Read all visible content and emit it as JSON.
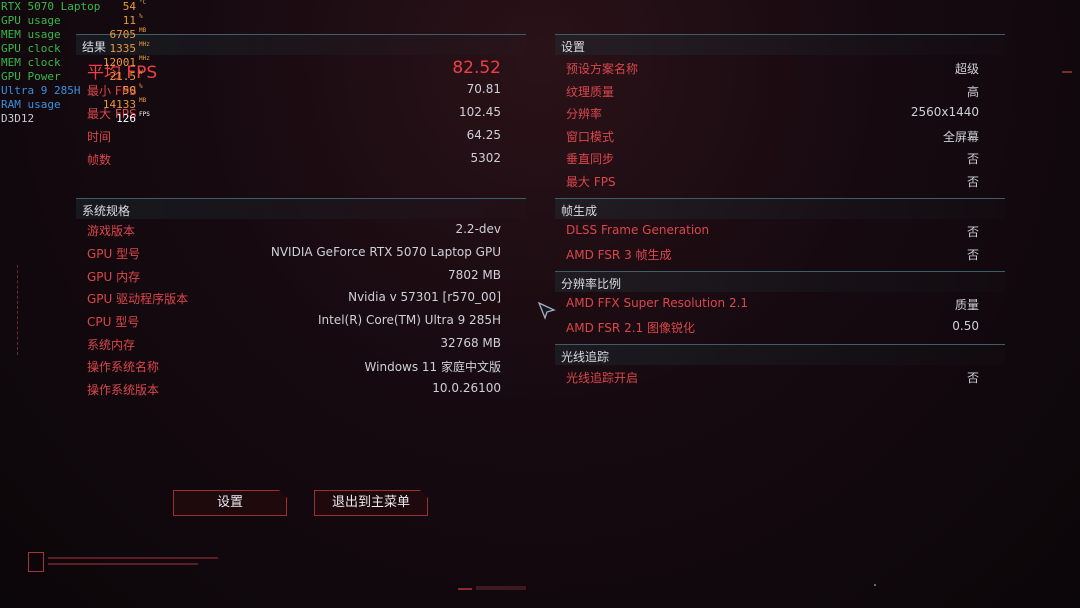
{
  "hud": [
    {
      "name": "RTX 5070 Laptop",
      "value": "54",
      "unit": "°C",
      "name_color": "#38b84a",
      "value_color": "#e89a3a"
    },
    {
      "name": "GPU usage",
      "value": "11",
      "unit": "%",
      "name_color": "#38b84a",
      "value_color": "#e89a3a"
    },
    {
      "name": "MEM usage",
      "value": "6705",
      "unit": "MB",
      "name_color": "#38b84a",
      "value_color": "#e89a3a"
    },
    {
      "name": "GPU clock",
      "value": "1335",
      "unit": "MHz",
      "name_color": "#38b84a",
      "value_color": "#e89a3a"
    },
    {
      "name": "MEM clock",
      "value": "12001",
      "unit": "MHz",
      "name_color": "#38b84a",
      "value_color": "#e89a3a"
    },
    {
      "name": "GPU Power",
      "value": "21.5",
      "unit": "W",
      "name_color": "#38b84a",
      "value_color": "#e89a3a"
    },
    {
      "name": "Ultra 9 285H",
      "value": "50",
      "unit": "%",
      "name_color": "#3a8fe0",
      "value_color": "#e89a3a"
    },
    {
      "name": "RAM usage",
      "value": "14133",
      "unit": "MB",
      "name_color": "#3a8fe0",
      "value_color": "#e89a3a"
    },
    {
      "name": "D3D12",
      "value": "126",
      "unit": "FPS",
      "name_color": "#c8ccd2",
      "value_color": "#ffffff"
    }
  ],
  "results": {
    "title": "结果",
    "rows": [
      {
        "label": "平均 FPS",
        "value": "82.52"
      },
      {
        "label": "最小 FPS",
        "value": "70.81"
      },
      {
        "label": "最大 FPS",
        "value": "102.45"
      },
      {
        "label": "时间",
        "value": "64.25"
      },
      {
        "label": "帧数",
        "value": "5302"
      }
    ]
  },
  "system": {
    "title": "系统规格",
    "rows": [
      {
        "label": "游戏版本",
        "value": "2.2-dev"
      },
      {
        "label": "GPU 型号",
        "value": "NVIDIA GeForce RTX 5070 Laptop GPU"
      },
      {
        "label": "GPU 内存",
        "value": "7802 MB"
      },
      {
        "label": "GPU 驱动程序版本",
        "value": "Nvidia v 57301 [r570_00]"
      },
      {
        "label": "CPU 型号",
        "value": "Intel(R) Core(TM) Ultra 9 285H"
      },
      {
        "label": "系统内存",
        "value": "32768 MB"
      },
      {
        "label": "操作系统名称",
        "value": "Windows 11 家庭中文版"
      },
      {
        "label": "操作系统版本",
        "value": "10.0.26100"
      }
    ]
  },
  "settings": {
    "title": "设置",
    "rows": [
      {
        "label": "预设方案名称",
        "value": "超级"
      },
      {
        "label": "纹理质量",
        "value": "高"
      },
      {
        "label": "分辨率",
        "value": "2560x1440"
      },
      {
        "label": "窗口模式",
        "value": "全屏幕"
      },
      {
        "label": "垂直同步",
        "value": "否"
      },
      {
        "label": "最大 FPS",
        "value": "否"
      }
    ]
  },
  "framegen": {
    "title": "帧生成",
    "rows": [
      {
        "label": "DLSS Frame Generation",
        "value": "否"
      },
      {
        "label": "AMD FSR 3 帧生成",
        "value": "否"
      }
    ]
  },
  "scaling": {
    "title": "分辨率比例",
    "rows": [
      {
        "label": "AMD FFX Super Resolution 2.1",
        "value": "质量"
      },
      {
        "label": "AMD FSR 2.1 图像锐化",
        "value": "0.50"
      }
    ]
  },
  "raytracing": {
    "title": "光线追踪",
    "rows": [
      {
        "label": "光线追踪开启",
        "value": "否"
      }
    ]
  },
  "buttons": {
    "settings": "设置",
    "exit": "退出到主菜单"
  },
  "colors": {
    "accent_red": "#d9474b",
    "header_line": "#3b5f66"
  }
}
